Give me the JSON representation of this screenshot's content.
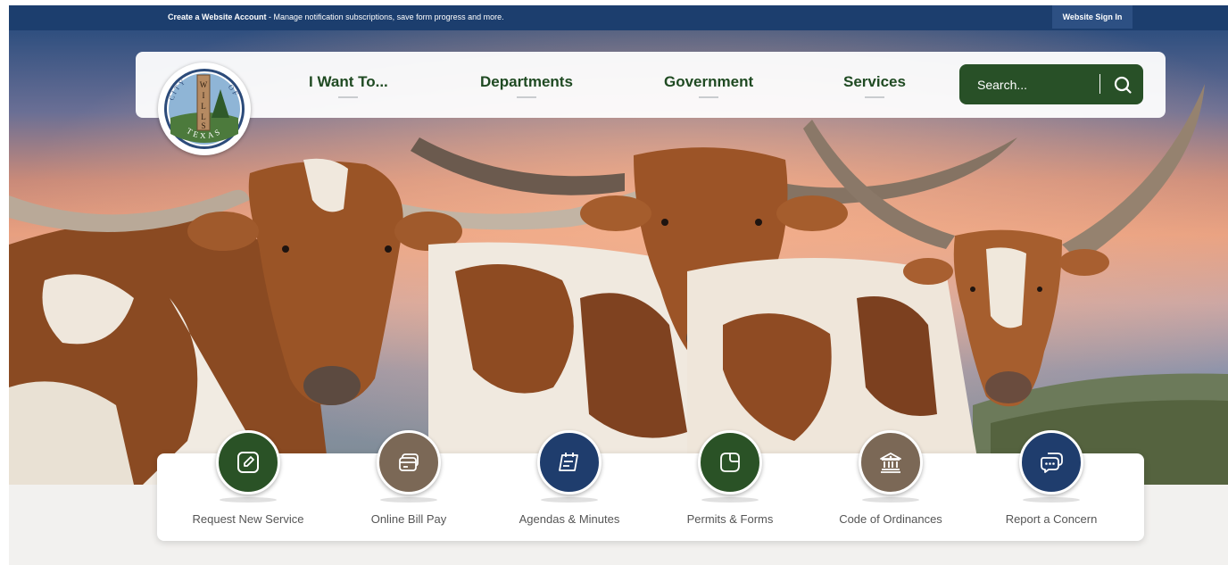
{
  "topbar": {
    "account_link": "Create a Website Account",
    "account_desc": " - Manage notification subscriptions, save form progress and more.",
    "sign_in": "Website Sign In"
  },
  "logo": {
    "top_text": "CITY OF",
    "name": "WILLIS",
    "bottom_text": "TEXAS"
  },
  "nav": {
    "items": [
      {
        "label": "I Want To..."
      },
      {
        "label": "Departments"
      },
      {
        "label": "Government"
      },
      {
        "label": "Services"
      }
    ]
  },
  "search": {
    "placeholder": "Search..."
  },
  "quick_links": [
    {
      "label": "Request New Service",
      "icon": "edit-icon",
      "color": "#2a5226"
    },
    {
      "label": "Online Bill Pay",
      "icon": "credit-card-icon",
      "color": "#7b6856"
    },
    {
      "label": "Agendas & Minutes",
      "icon": "calendar-icon",
      "color": "#1f3d6d"
    },
    {
      "label": "Permits & Forms",
      "icon": "document-icon",
      "color": "#2a5226"
    },
    {
      "label": "Code of Ordinances",
      "icon": "courthouse-icon",
      "color": "#7b6856"
    },
    {
      "label": "Report a Concern",
      "icon": "chat-icon",
      "color": "#1f3d6d"
    }
  ],
  "colors": {
    "topbar": "#1c3e6e",
    "accent_green": "#285027",
    "brown": "#7b6856",
    "navy": "#1f3d6d"
  }
}
